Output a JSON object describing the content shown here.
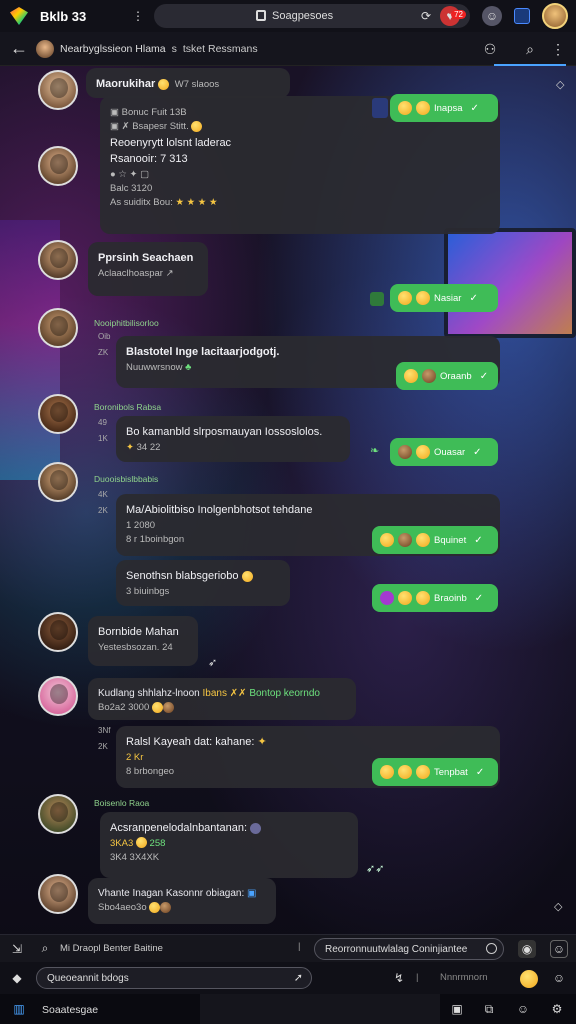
{
  "statusbar": {
    "app_title": "Bklb 33",
    "url": "Soagpesoes",
    "notif_count": "72"
  },
  "header": {
    "title": "Nearbyglssieon Hlama",
    "sub1": "s",
    "sub2": "tsket Ressmans"
  },
  "messages": {
    "m1": {
      "title": "Maorukihar",
      "title_tail": " W7 slaoos",
      "line1": "Bonuc Fuit 13B",
      "line2": "Bsapesr Stitt.",
      "line3": "Reoenyrytt lolsnt laderac",
      "line4": "Rsanooir: 7 313",
      "line5": "Balc 3120",
      "line6": "As suiditx Bou:"
    },
    "m1_pill": "Inapsa",
    "m2": {
      "title": "Pprsinh Seachaen",
      "line1": "Aclaaclhoaspar"
    },
    "m2_pill": "Nasiar",
    "m3_sender": "Nooiphitbilisorloo",
    "m3_g1": "Oib",
    "m3_g2": "ZK",
    "m3": {
      "title": "Blastotel Inge lacitaarjodgotj.",
      "line1": "Nuuwwrsnow"
    },
    "m3_pill": "Oraanb",
    "m4_sender": "Boronibols Rabsa",
    "m4_g1": "49",
    "m4_g2": "1K",
    "m4": {
      "title": "Bo kamanbld slrposmauyan Iossoslolos.",
      "line1": "34 22"
    },
    "m4_pill": "Ouasar",
    "m5_sender": "Duooisbislbbabis",
    "m5_g1": "4K",
    "m5_g2": "2K",
    "m5": {
      "title": "Ma/Abiolitbiso Inolgenbhotsot tehdane",
      "line1": "1 2080",
      "line2": "8 r 1boinbgon"
    },
    "m5_pill": "Bquinet",
    "m6": {
      "title": "Senothsn blabsgeriobo",
      "line1": "3 biuinbgs"
    },
    "m6_pill": "Braoinb",
    "m7": {
      "title": "Bornbide Mahan",
      "line1": "Yestesbsozan. 24"
    },
    "m8": {
      "title": "Kudlang shhlahz-lnoon",
      "title_g": "Ibans",
      "title_r": "Bontop keorndo",
      "line1": "Bo2a2 3000"
    },
    "m8_g1": "3Nf",
    "m8_g2": "2K",
    "m9": {
      "title": "Ralsl Kayeah dat: kahane:",
      "line1": "2 Kr",
      "line2": "8 brbongeo"
    },
    "m9_pill": "Tenpbat",
    "m10_sender": "Boisenlo Raoa",
    "m10": {
      "title": "Acsranpenelodalnbantanan:",
      "line1": "3KA3",
      "line1b": "258",
      "line2": "3K4 3X4XK"
    },
    "m11": {
      "title": "Vhante Inagan Kasonnr obiagan:",
      "line1": "Sbo4aeo3o"
    }
  },
  "composer": {
    "left_text": "Mi Draopl Benter Baitine",
    "right_placeholder": "Reorronnuutwlalag Coninjiantee",
    "bottom_input": "Queoeannit bdogs",
    "bottom_right": "Nnnrmnorn"
  },
  "taskbar": {
    "label": "Soaatesgae"
  }
}
